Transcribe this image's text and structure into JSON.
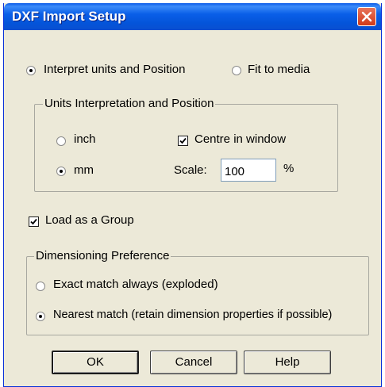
{
  "window": {
    "title": "DXF Import Setup"
  },
  "mode": {
    "interpret_label": "Interpret units and Position",
    "interpret_selected": true,
    "fit_label": "Fit to media",
    "fit_selected": false
  },
  "units_group": {
    "legend": "Units Interpretation and Position",
    "inch_label": "inch",
    "inch_selected": false,
    "mm_label": "mm",
    "mm_selected": true,
    "centre_label": "Centre in window",
    "centre_checked": true,
    "scale_label": "Scale:",
    "scale_value": "100",
    "scale_unit": "%"
  },
  "load_group": {
    "label": "Load as a Group",
    "checked": true
  },
  "dimensioning": {
    "legend": "Dimensioning Preference",
    "exact_label": "Exact match always (exploded)",
    "exact_selected": false,
    "nearest_label": "Nearest match (retain dimension properties if possible)",
    "nearest_selected": true
  },
  "buttons": {
    "ok": "OK",
    "cancel": "Cancel",
    "help": "Help"
  },
  "icons": {
    "close": "close-icon",
    "check": "check-icon"
  }
}
